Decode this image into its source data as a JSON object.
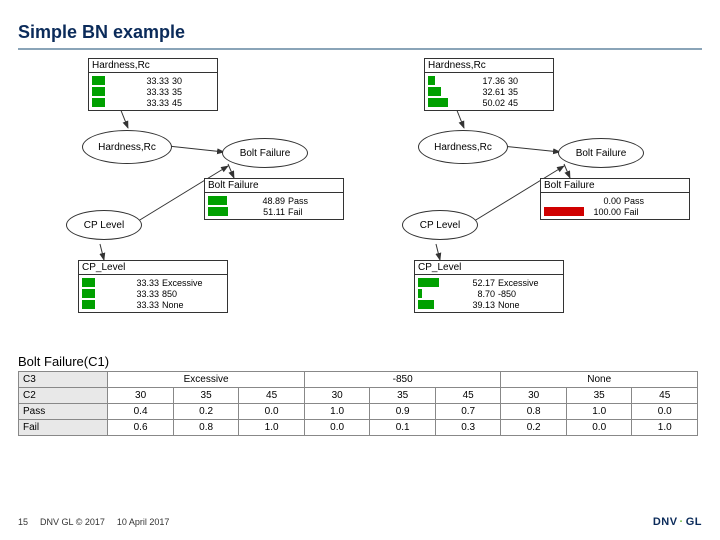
{
  "title": "Simple BN example",
  "left": {
    "hardness_box": {
      "title": "Hardness,Rc",
      "rows": [
        {
          "pct": "33.33",
          "label": "30"
        },
        {
          "pct": "33.33",
          "label": "35"
        },
        {
          "pct": "33.33",
          "label": "45"
        }
      ]
    },
    "hardness_ellipse": "Hardness,Rc",
    "boltfailure_ellipse": "Bolt Failure",
    "boltfailure_box": {
      "title": "Bolt Failure",
      "rows": [
        {
          "pct": "48.89",
          "label": "Pass"
        },
        {
          "pct": "51.11",
          "label": "Fail"
        }
      ]
    },
    "cp_ellipse": "CP Level",
    "cp_box": {
      "title": "CP_Level",
      "rows": [
        {
          "pct": "33.33",
          "label": "Excessive"
        },
        {
          "pct": "33.33",
          "label": "850"
        },
        {
          "pct": "33.33",
          "label": "None"
        }
      ]
    }
  },
  "right": {
    "hardness_box": {
      "title": "Hardness,Rc",
      "rows": [
        {
          "pct": "17.36",
          "label": "30"
        },
        {
          "pct": "32.61",
          "label": "35"
        },
        {
          "pct": "50.02",
          "label": "45"
        }
      ]
    },
    "hardness_ellipse": "Hardness,Rc",
    "boltfailure_ellipse": "Bolt Failure",
    "boltfailure_box": {
      "title": "Bolt Failure",
      "rows": [
        {
          "pct": "0.00",
          "label": "Pass",
          "color": "green"
        },
        {
          "pct": "100.00",
          "label": "Fail",
          "color": "red"
        }
      ]
    },
    "cp_ellipse": "CP Level",
    "cp_box": {
      "title": "CP_Level",
      "rows": [
        {
          "pct": "52.17",
          "label": "Excessive"
        },
        {
          "pct": "8.70",
          "label": "-850"
        },
        {
          "pct": "39.13",
          "label": "None"
        }
      ]
    }
  },
  "cpt": {
    "title": "Bolt Failure(C1)",
    "c3_label": "C3",
    "c2_label": "C2",
    "c3_groups": [
      "Excessive",
      "-850",
      "None"
    ],
    "c2_values": [
      "30",
      "35",
      "45"
    ],
    "rows": [
      {
        "label": "Pass",
        "values": [
          "0.4",
          "0.2",
          "0.0",
          "1.0",
          "0.9",
          "0.7",
          "0.8",
          "1.0",
          "0.0"
        ]
      },
      {
        "label": "Fail",
        "values": [
          "0.6",
          "0.8",
          "1.0",
          "0.0",
          "0.1",
          "0.3",
          "0.2",
          "0.0",
          "1.0"
        ]
      }
    ]
  },
  "footer": {
    "slide": "15",
    "copyright": "DNV GL © 2017",
    "date": "10 April 2017",
    "logo_a": "DNV",
    "logo_b": "GL"
  },
  "chart_data": {
    "type": "table",
    "description": "Bayesian network with two configurations (left prior, right evidence) and CPT",
    "left_network": {
      "Hardness_Rc": {
        "30": 33.33,
        "35": 33.33,
        "45": 33.33
      },
      "CP_Level": {
        "Excessive": 33.33,
        "850": 33.33,
        "None": 33.33
      },
      "Bolt_Failure": {
        "Pass": 48.89,
        "Fail": 51.11
      }
    },
    "right_network": {
      "Hardness_Rc": {
        "30": 17.36,
        "35": 32.61,
        "45": 50.02
      },
      "CP_Level": {
        "Excessive": 52.17,
        "-850": 8.7,
        "None": 39.13
      },
      "Bolt_Failure": {
        "Pass": 0.0,
        "Fail": 100.0
      }
    },
    "cpt_Bolt_Failure_given_C1": {
      "parents": [
        "C3 (CP_Level)",
        "C2 (Hardness)"
      ],
      "C3": [
        "Excessive",
        "Excessive",
        "Excessive",
        "-850",
        "-850",
        "-850",
        "None",
        "None",
        "None"
      ],
      "C2": [
        "30",
        "35",
        "45",
        "30",
        "35",
        "45",
        "30",
        "35",
        "45"
      ],
      "Pass": [
        0.4,
        0.2,
        0.0,
        1.0,
        0.9,
        0.7,
        0.8,
        1.0,
        0.0
      ],
      "Fail": [
        0.6,
        0.8,
        1.0,
        0.0,
        0.1,
        0.3,
        0.2,
        0.0,
        1.0
      ]
    }
  }
}
